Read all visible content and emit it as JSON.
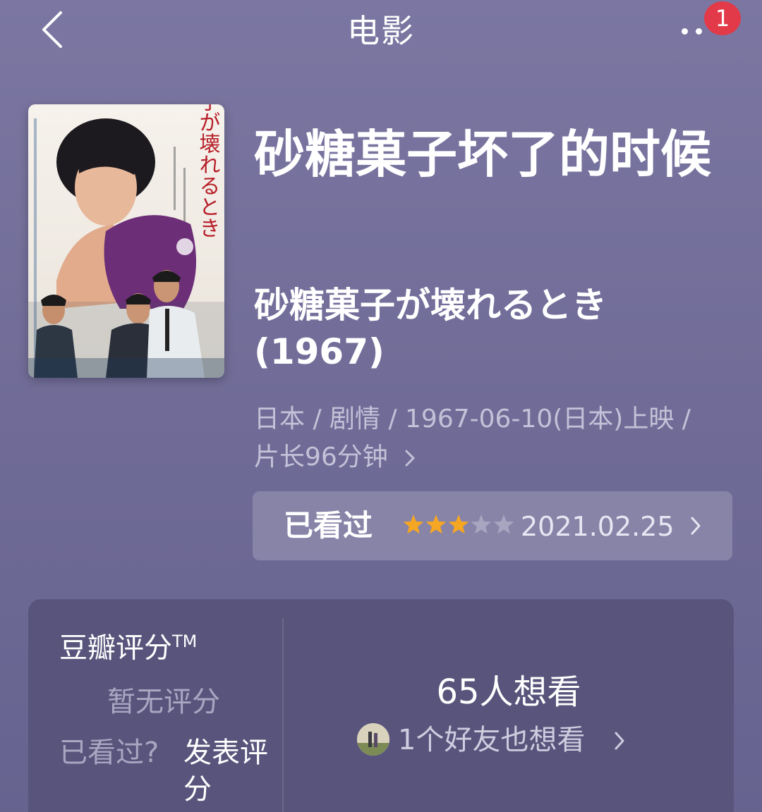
{
  "nav": {
    "title": "电影",
    "notification_count": "1"
  },
  "movie": {
    "title_cn": "砂糖菓子坏了的时候",
    "original_title": "砂糖菓子が壊れるとき",
    "year": "(1967)",
    "meta": "日本 / 剧情 / 1967-06-10(日本)上映 / 片长96分钟",
    "poster": {
      "title_text": "砂糖菓子が壊れるとき"
    }
  },
  "my_status": {
    "label": "已看过",
    "stars_filled": 3,
    "stars_total": 5,
    "date": "2021.02.25"
  },
  "rating": {
    "title": "豆瓣评分",
    "trademark": "TM",
    "no_score": "暂无评分",
    "watched_question": "已看过?",
    "write_review": "发表评分"
  },
  "want": {
    "count_text": "65人想看",
    "friends_text": "1个好友也想看"
  },
  "colors": {
    "star_filled": "#f5a623",
    "star_empty": "#a8a5c0",
    "badge": "#e23a48"
  }
}
